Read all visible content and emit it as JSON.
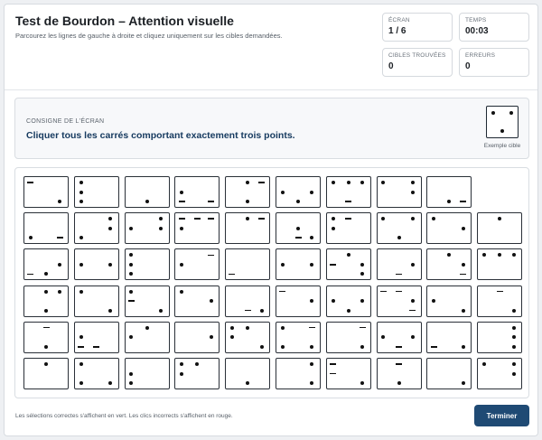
{
  "header": {
    "title": "Test de Bourdon – Attention visuelle",
    "subtitle": "Parcourez les lignes de gauche à droite et cliquez uniquement sur les cibles demandées."
  },
  "stats": {
    "screen": {
      "label": "ÉCRAN",
      "value": "1 / 6"
    },
    "time": {
      "label": "TEMPS",
      "value": "00:03"
    },
    "found": {
      "label": "CIBLES TROUVÉES",
      "value": "0"
    },
    "errors": {
      "label": "ERREURS",
      "value": "0"
    }
  },
  "instruction": {
    "label": "CONSIGNE DE L'ÉCRAN",
    "text": "Cliquer tous les carrés comportant exactement trois points.",
    "example_caption": "Exemple cible",
    "example_dots": [
      [
        0.2,
        0.2
      ],
      [
        0.8,
        0.2
      ],
      [
        0.5,
        0.8
      ]
    ]
  },
  "grid": {
    "rows": [
      [
        {
          "d": [
            [
              0.82,
              0.82
            ]
          ],
          "l": [
            [
              0.14,
              0.18
            ]
          ]
        },
        {
          "d": [
            [
              0.14,
              0.18
            ],
            [
              0.14,
              0.5
            ],
            [
              0.14,
              0.82
            ]
          ]
        },
        {
          "d": [
            [
              0.5,
              0.82
            ]
          ]
        },
        {
          "d": [
            [
              0.14,
              0.5
            ]
          ],
          "l": [
            [
              0.14,
              0.82
            ],
            [
              0.82,
              0.82
            ]
          ]
        },
        {
          "d": [
            [
              0.5,
              0.18
            ],
            [
              0.5,
              0.82
            ]
          ],
          "l": [
            [
              0.82,
              0.18
            ]
          ]
        },
        {
          "d": [
            [
              0.14,
              0.5
            ],
            [
              0.82,
              0.5
            ],
            [
              0.5,
              0.82
            ]
          ]
        },
        {
          "d": [
            [
              0.14,
              0.18
            ],
            [
              0.5,
              0.18
            ],
            [
              0.82,
              0.18
            ]
          ],
          "l": [
            [
              0.5,
              0.82
            ]
          ]
        },
        {
          "d": [
            [
              0.14,
              0.18
            ],
            [
              0.82,
              0.18
            ],
            [
              0.82,
              0.5
            ]
          ]
        },
        {
          "d": [
            [
              0.5,
              0.82
            ]
          ],
          "l": [
            [
              0.82,
              0.82
            ]
          ]
        }
      ],
      [
        {
          "d": [
            [
              0.14,
              0.82
            ]
          ],
          "l": [
            [
              0.82,
              0.82
            ]
          ]
        },
        {
          "d": [
            [
              0.82,
              0.18
            ],
            [
              0.82,
              0.5
            ],
            [
              0.14,
              0.82
            ]
          ]
        },
        {
          "d": [
            [
              0.14,
              0.5
            ],
            [
              0.82,
              0.18
            ],
            [
              0.82,
              0.5
            ]
          ]
        },
        {
          "d": [
            [
              0.14,
              0.5
            ]
          ],
          "l": [
            [
              0.14,
              0.18
            ],
            [
              0.5,
              0.18
            ],
            [
              0.82,
              0.18
            ]
          ]
        },
        {
          "d": [
            [
              0.5,
              0.18
            ]
          ],
          "l": [
            [
              0.82,
              0.18
            ]
          ]
        },
        {
          "d": [
            [
              0.82,
              0.82
            ],
            [
              0.5,
              0.5
            ]
          ],
          "l": [
            [
              0.5,
              0.82
            ]
          ]
        },
        {
          "d": [
            [
              0.14,
              0.18
            ],
            [
              0.14,
              0.5
            ]
          ],
          "l": [
            [
              0.5,
              0.18
            ]
          ]
        },
        {
          "d": [
            [
              0.14,
              0.18
            ],
            [
              0.82,
              0.18
            ],
            [
              0.5,
              0.82
            ]
          ]
        },
        {
          "d": [
            [
              0.14,
              0.18
            ],
            [
              0.82,
              0.5
            ]
          ]
        },
        {
          "d": [
            [
              0.5,
              0.18
            ]
          ]
        }
      ],
      [
        {
          "d": [
            [
              0.5,
              0.82
            ],
            [
              0.82,
              0.5
            ]
          ],
          "l": [
            [
              0.14,
              0.82
            ]
          ]
        },
        {
          "d": [
            [
              0.14,
              0.5
            ],
            [
              0.82,
              0.5
            ]
          ]
        },
        {
          "d": [
            [
              0.14,
              0.18
            ],
            [
              0.14,
              0.5
            ],
            [
              0.14,
              0.82
            ]
          ]
        },
        {
          "d": [
            [
              0.14,
              0.5
            ]
          ],
          "l": [
            [
              0.82,
              0.18
            ]
          ]
        },
        {
          "l": [
            [
              0.14,
              0.82
            ]
          ]
        },
        {
          "d": [
            [
              0.14,
              0.5
            ],
            [
              0.82,
              0.5
            ]
          ]
        },
        {
          "d": [
            [
              0.5,
              0.18
            ],
            [
              0.82,
              0.5
            ],
            [
              0.82,
              0.82
            ]
          ],
          "l": [
            [
              0.14,
              0.5
            ]
          ]
        },
        {
          "d": [
            [
              0.82,
              0.5
            ]
          ],
          "l": [
            [
              0.5,
              0.82
            ]
          ]
        },
        {
          "d": [
            [
              0.82,
              0.5
            ],
            [
              0.5,
              0.18
            ]
          ],
          "l": [
            [
              0.82,
              0.82
            ]
          ]
        },
        {
          "d": [
            [
              0.14,
              0.18
            ],
            [
              0.5,
              0.18
            ],
            [
              0.82,
              0.18
            ]
          ]
        }
      ],
      [
        {
          "d": [
            [
              0.5,
              0.18
            ],
            [
              0.82,
              0.18
            ],
            [
              0.5,
              0.82
            ]
          ]
        },
        {
          "d": [
            [
              0.14,
              0.18
            ],
            [
              0.82,
              0.82
            ]
          ]
        },
        {
          "d": [
            [
              0.14,
              0.18
            ],
            [
              0.82,
              0.82
            ]
          ],
          "l": [
            [
              0.14,
              0.5
            ]
          ]
        },
        {
          "d": [
            [
              0.14,
              0.18
            ],
            [
              0.82,
              0.5
            ]
          ]
        },
        {
          "d": [
            [
              0.82,
              0.82
            ]
          ],
          "l": [
            [
              0.5,
              0.82
            ]
          ]
        },
        {
          "d": [
            [
              0.82,
              0.5
            ]
          ],
          "l": [
            [
              0.14,
              0.18
            ]
          ]
        },
        {
          "d": [
            [
              0.14,
              0.5
            ],
            [
              0.82,
              0.5
            ],
            [
              0.5,
              0.82
            ]
          ]
        },
        {
          "d": [
            [
              0.82,
              0.5
            ]
          ],
          "l": [
            [
              0.14,
              0.18
            ],
            [
              0.5,
              0.18
            ],
            [
              0.82,
              0.82
            ]
          ]
        },
        {
          "d": [
            [
              0.14,
              0.5
            ],
            [
              0.82,
              0.82
            ]
          ]
        },
        {
          "d": [
            [
              0.82,
              0.82
            ]
          ],
          "l": [
            [
              0.5,
              0.18
            ]
          ]
        }
      ],
      [
        {
          "d": [
            [
              0.5,
              0.82
            ]
          ],
          "l": [
            [
              0.5,
              0.18
            ]
          ]
        },
        {
          "d": [
            [
              0.14,
              0.5
            ]
          ],
          "l": [
            [
              0.14,
              0.82
            ],
            [
              0.5,
              0.82
            ]
          ]
        },
        {
          "d": [
            [
              0.5,
              0.18
            ],
            [
              0.14,
              0.5
            ]
          ]
        },
        {
          "d": [
            [
              0.82,
              0.5
            ]
          ]
        },
        {
          "d": [
            [
              0.14,
              0.18
            ],
            [
              0.5,
              0.18
            ],
            [
              0.14,
              0.5
            ],
            [
              0.82,
              0.82
            ]
          ]
        },
        {
          "d": [
            [
              0.14,
              0.18
            ],
            [
              0.82,
              0.82
            ],
            [
              0.14,
              0.82
            ]
          ],
          "l": [
            [
              0.82,
              0.18
            ]
          ]
        },
        {
          "d": [
            [
              0.82,
              0.82
            ]
          ],
          "l": [
            [
              0.82,
              0.18
            ]
          ]
        },
        {
          "d": [
            [
              0.14,
              0.5
            ],
            [
              0.82,
              0.5
            ]
          ],
          "l": [
            [
              0.5,
              0.82
            ]
          ]
        },
        {
          "d": [
            [
              0.82,
              0.82
            ]
          ],
          "l": [
            [
              0.14,
              0.82
            ]
          ]
        },
        {
          "d": [
            [
              0.82,
              0.18
            ],
            [
              0.82,
              0.5
            ],
            [
              0.82,
              0.82
            ]
          ]
        }
      ],
      [
        {
          "d": [
            [
              0.5,
              0.18
            ]
          ]
        },
        {
          "d": [
            [
              0.14,
              0.18
            ],
            [
              0.14,
              0.82
            ],
            [
              0.82,
              0.82
            ]
          ]
        },
        {
          "d": [
            [
              0.14,
              0.5
            ],
            [
              0.14,
              0.82
            ]
          ]
        },
        {
          "d": [
            [
              0.14,
              0.18
            ],
            [
              0.5,
              0.18
            ],
            [
              0.14,
              0.5
            ]
          ]
        },
        {
          "d": [
            [
              0.5,
              0.82
            ]
          ]
        },
        {
          "d": [
            [
              0.82,
              0.18
            ],
            [
              0.82,
              0.82
            ]
          ]
        },
        {
          "d": [
            [
              0.82,
              0.82
            ]
          ],
          "l": [
            [
              0.14,
              0.18
            ],
            [
              0.14,
              0.5
            ]
          ]
        },
        {
          "d": [
            [
              0.5,
              0.82
            ]
          ],
          "l": [
            [
              0.5,
              0.18
            ]
          ]
        },
        {
          "d": [
            [
              0.82,
              0.82
            ]
          ]
        },
        {
          "d": [
            [
              0.14,
              0.18
            ],
            [
              0.82,
              0.18
            ],
            [
              0.82,
              0.5
            ]
          ]
        }
      ]
    ]
  },
  "footer": {
    "note": "Les sélections correctes s'affichent en vert. Les clics incorrects s'affichent en rouge.",
    "finish_label": "Terminer"
  },
  "colors": {
    "accent": "#1f4a74",
    "instruction_text": "#173b60"
  }
}
